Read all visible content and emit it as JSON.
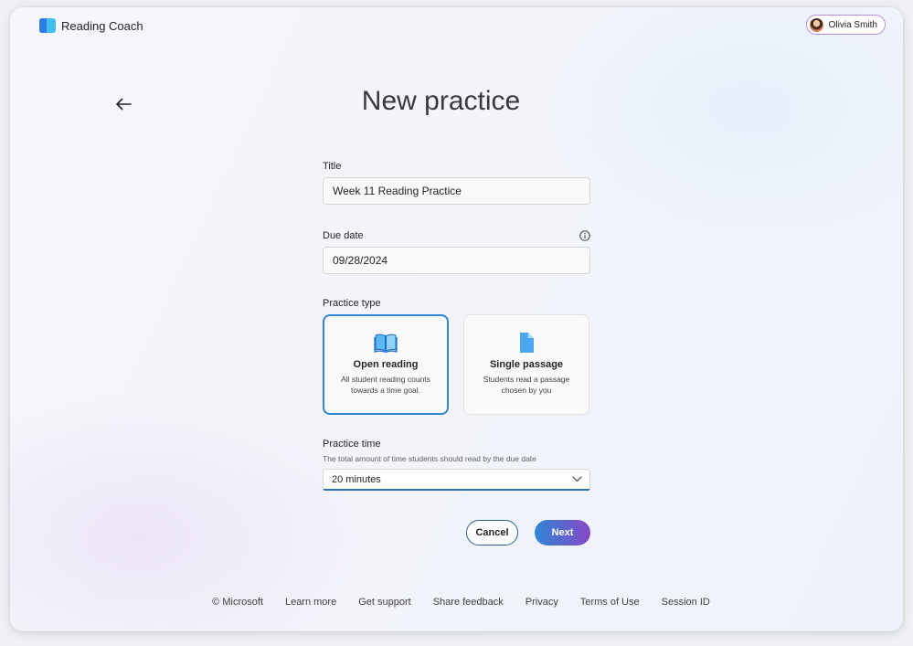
{
  "app": {
    "name": "Reading Coach"
  },
  "user": {
    "name": "Olivia Smith"
  },
  "page": {
    "title": "New practice"
  },
  "form": {
    "title_label": "Title",
    "title_value": "Week 11 Reading Practice",
    "due_label": "Due date",
    "due_value": "09/28/2024",
    "type_label": "Practice type",
    "types": [
      {
        "title": "Open reading",
        "desc": "All student reading counts towards a time goal.",
        "selected": true
      },
      {
        "title": "Single passage",
        "desc": "Students read a passage chosen by you",
        "selected": false
      }
    ],
    "time_label": "Practice time",
    "time_hint": "The total amount of time students should read by the due date",
    "time_value": "20 minutes"
  },
  "actions": {
    "cancel": "Cancel",
    "next": "Next"
  },
  "footer": {
    "copyright": "© Microsoft",
    "links": [
      "Learn more",
      "Get support",
      "Share feedback",
      "Privacy",
      "Terms of Use",
      "Session ID"
    ]
  },
  "colors": {
    "accent": "#2f86d4",
    "next_gradient_end": "#8748c6"
  }
}
